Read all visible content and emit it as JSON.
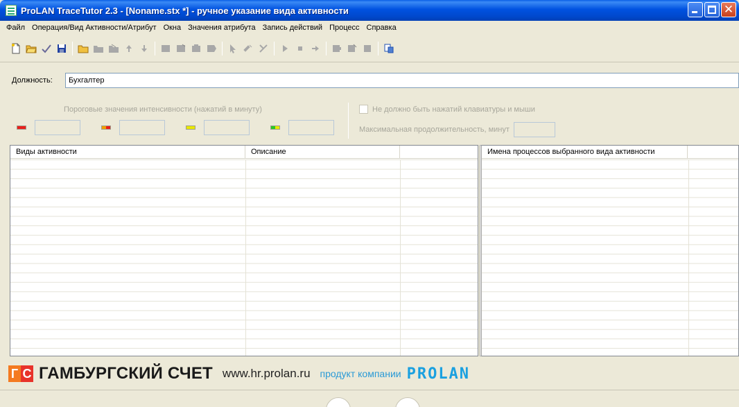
{
  "window": {
    "title": "ProLAN TraceTutor 2.3 - [Noname.stx *] - ручное указание вида активности"
  },
  "menu": [
    "Файл",
    "Операция/Вид Активности/Атрибут",
    "Окна",
    "Значения атрибута",
    "Запись действий",
    "Процесс",
    "Справка"
  ],
  "position": {
    "label": "Должность:",
    "value": "Бухгалтер"
  },
  "thresholds": {
    "title": "Пороговые значения интенсивности (нажатий в минуту)",
    "swatch_colors": [
      "#e8201c",
      "#f0a000",
      "#e8e800",
      "#28c828"
    ],
    "no_input_label": "Не должно быть нажатий клавиатуры и мыши",
    "max_duration_label": "Максимальная продолжительность, минут"
  },
  "activities_table": {
    "columns": [
      "Виды активности",
      "Описание",
      ""
    ]
  },
  "processes_table": {
    "columns": [
      "Имена процессов выбранного вида активности",
      ""
    ]
  },
  "banner": {
    "logo_left": "Г",
    "logo_right": "С",
    "brand": "ГАМБУРГСКИЙ СЧЕТ",
    "site": "www.hr.prolan.ru",
    "product": "продукт компании",
    "company": "PROLAN"
  }
}
